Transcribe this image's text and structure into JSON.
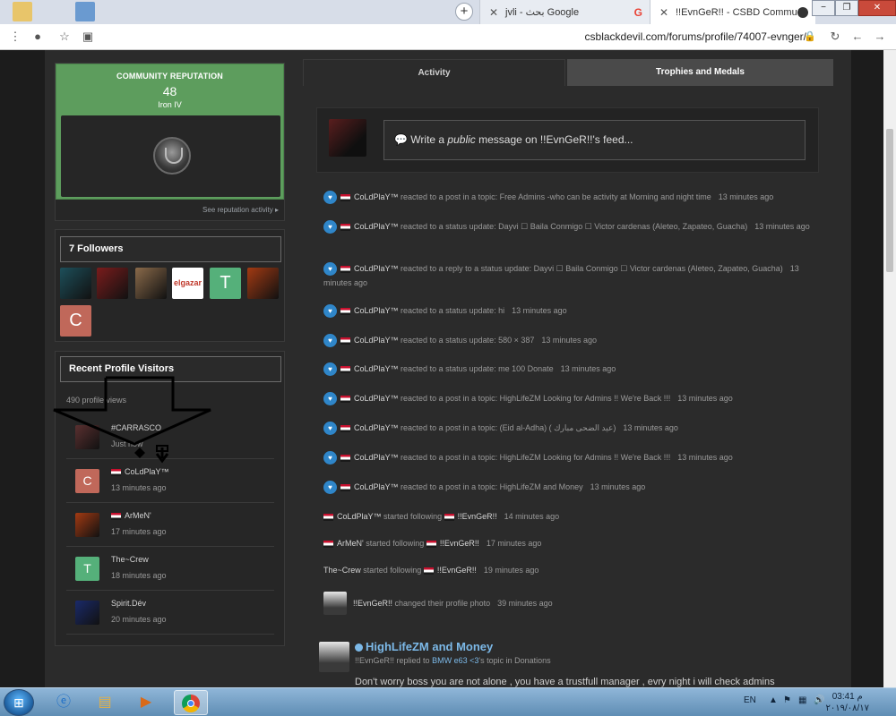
{
  "browser": {
    "tabs": [
      {
        "title": "jvli - بحث Google"
      },
      {
        "title": "!!EvnGeR!! - CSBD Community"
      }
    ],
    "new_tab": "+",
    "url": "csblackdevil.com/forums/profile/74007-evnger/"
  },
  "reputation": {
    "title": "COMMUNITY REPUTATION",
    "value": "48",
    "rank": "Iron IV",
    "link": "See reputation activity"
  },
  "followers": {
    "title": "7 Followers",
    "items": [
      {
        "kind": "image",
        "color": "#1d4f5a"
      },
      {
        "kind": "image",
        "color": "#7a1c1c"
      },
      {
        "kind": "image",
        "color": "#8a6a4a"
      },
      {
        "kind": "text",
        "label": "elgazar",
        "bg": "#ffffff",
        "fg": "#c0392b"
      },
      {
        "kind": "letter",
        "label": "T",
        "bg": "#55b07a"
      },
      {
        "kind": "image",
        "color": "#a33a12"
      },
      {
        "kind": "letter",
        "label": "C",
        "bg": "#c0685a"
      }
    ]
  },
  "visitors": {
    "title": "Recent Profile Visitors",
    "views": "490 profile views",
    "rows": [
      {
        "name": "#CARRASCO",
        "time": "Just now",
        "avatar": "image",
        "color": "#5a3030",
        "flag": false
      },
      {
        "name": "CoLdPlaY™",
        "time": "13 minutes ago",
        "avatar": "letter",
        "letter": "C",
        "color": "#c0685a",
        "flag": true
      },
      {
        "name": "ArMeN'",
        "time": "17 minutes ago",
        "avatar": "image",
        "color": "#a33a12",
        "flag": true
      },
      {
        "name": "The~Crew",
        "time": "18 minutes ago",
        "avatar": "letter",
        "letter": "T",
        "color": "#55b07a",
        "flag": false
      },
      {
        "name": "Spirit.Dév",
        "time": "20 minutes ago",
        "avatar": "image",
        "color": "#1a2a6a",
        "flag": false
      }
    ]
  },
  "profile_tabs": {
    "activity": "Activity",
    "trophies": "Trophies and Medals"
  },
  "composer": {
    "prefix": "Write a ",
    "emphasis": "public",
    "suffix": " message on !!EvnGeR!!'s feed..."
  },
  "feed": [
    {
      "type": "reaction",
      "user": "CoLdPlaY™",
      "text": "reacted to a post in a topic: Free Admins -who can be activity at Morning and night time",
      "time": "13 minutes ago"
    },
    {
      "type": "reaction",
      "user": "CoLdPlaY™",
      "text": "reacted to a status update: Dayvi ☐ Baila Conmigo ☐ Victor cardenas (Aleteo, Zapateo, Guacha)",
      "time": "13 minutes ago"
    },
    {
      "type": "reaction",
      "user": "CoLdPlaY™",
      "text": "reacted to a reply to a status update: Dayvi ☐ Baila Conmigo ☐ Victor cardenas (Aleteo, Zapateo, Guacha)",
      "time": "13 minutes ago"
    },
    {
      "type": "reaction",
      "user": "CoLdPlaY™",
      "text": "reacted to a status update: hi",
      "time": "13 minutes ago"
    },
    {
      "type": "reaction",
      "user": "CoLdPlaY™",
      "text": "reacted to a status update: 580 × 387",
      "time": "13 minutes ago"
    },
    {
      "type": "reaction",
      "user": "CoLdPlaY™",
      "text": "reacted to a status update: me 100 Donate",
      "time": "13 minutes ago"
    },
    {
      "type": "reaction",
      "user": "CoLdPlaY™",
      "text": "reacted to a post in a topic: HighLifeZM Looking for Admins !! We're Back !!!",
      "time": "13 minutes ago"
    },
    {
      "type": "reaction",
      "user": "CoLdPlaY™",
      "text": "reacted to a post in a topic: (Eid al-Adha) ( عيد الضحى مبارك)",
      "time": "13 minutes ago"
    },
    {
      "type": "reaction",
      "user": "CoLdPlaY™",
      "text": "reacted to a post in a topic: HighLifeZM Looking for Admins !! We're Back !!!",
      "time": "13 minutes ago"
    },
    {
      "type": "reaction",
      "user": "CoLdPlaY™",
      "text": "reacted to a post in a topic: HighLifeZM and Money",
      "time": "13 minutes ago"
    },
    {
      "type": "follow",
      "user": "CoLdPlaY™",
      "flag": true,
      "text": "started following",
      "target": "!!EvnGeR!!",
      "time": "14 minutes ago"
    },
    {
      "type": "follow",
      "user": "ArMeN'",
      "flag": true,
      "text": "started following",
      "target": "!!EvnGeR!!",
      "time": "17 minutes ago"
    },
    {
      "type": "follow",
      "user": "The~Crew",
      "flag": false,
      "text": "started following",
      "target": "!!EvnGeR!!",
      "time": "19 minutes ago"
    },
    {
      "type": "photo",
      "user": "!!EvnGeR!!",
      "text": "changed their profile photo",
      "time": "39 minutes ago"
    }
  ],
  "post": {
    "title": "HighLifeZM and Money",
    "author": "!!EvnGeR!!",
    "action": "replied to",
    "target": "BMW e63 <3",
    "suffix": "'s topic in Donations",
    "body": "Don't worry boss you are not alone , you have a trustfull manager , evry night i will check admins"
  },
  "taskbar": {
    "lang": "EN",
    "time": "03:41 م",
    "date": "٢٠١٩/٠٨/١٧"
  },
  "colors": {
    "accent": "#7cb9e8",
    "reputation": "#5d9d5d",
    "heart": "#2f86c9"
  }
}
